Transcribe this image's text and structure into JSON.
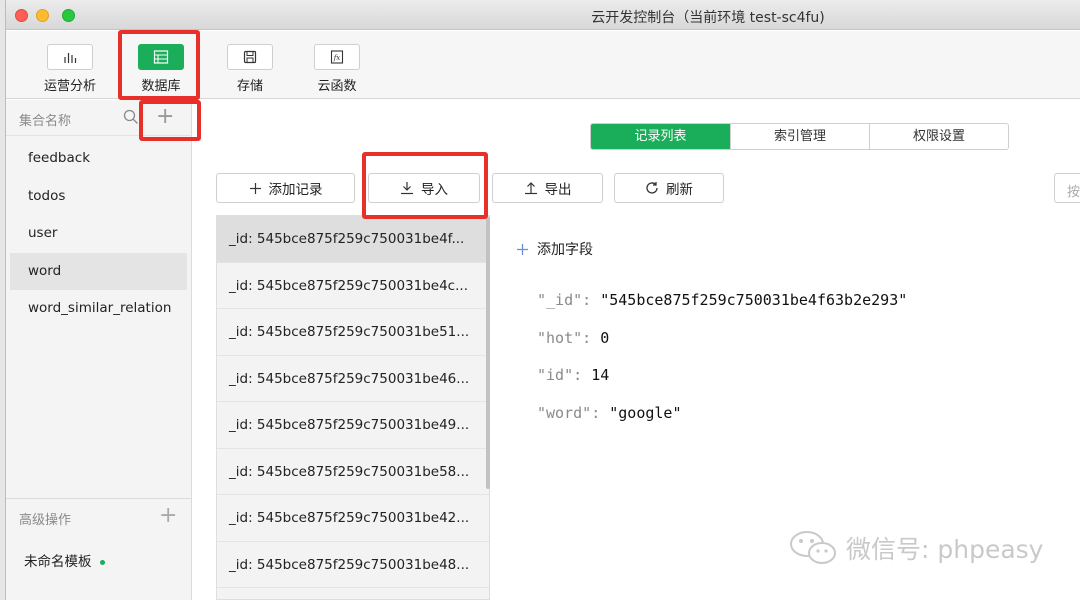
{
  "window": {
    "title": "云开发控制台（当前环境 test-sc4fu)"
  },
  "toolbar": {
    "items": [
      {
        "label": "运营分析",
        "icon": "bar-chart-icon"
      },
      {
        "label": "数据库",
        "icon": "database-icon",
        "active": true
      },
      {
        "label": "存储",
        "icon": "save-disk-icon"
      },
      {
        "label": "云函数",
        "icon": "function-icon"
      }
    ]
  },
  "sidebar": {
    "header": "集合名称",
    "collections": [
      "feedback",
      "todos",
      "user",
      "word",
      "word_similar_relation"
    ],
    "selected": "word",
    "advanced_header": "高级操作",
    "template": "未命名模板"
  },
  "tabs": [
    {
      "label": "记录列表",
      "active": true
    },
    {
      "label": "索引管理"
    },
    {
      "label": "权限设置"
    }
  ],
  "actions": {
    "add": "添加记录",
    "import": "导入",
    "export": "导出",
    "refresh": "刷新",
    "search_placeholder": "按"
  },
  "records": [
    "_id: 545bce875f259c750031be4f...",
    "_id: 545bce875f259c750031be4c...",
    "_id: 545bce875f259c750031be51...",
    "_id: 545bce875f259c750031be46...",
    "_id: 545bce875f259c750031be49...",
    "_id: 545bce875f259c750031be58...",
    "_id: 545bce875f259c750031be42...",
    "_id: 545bce875f259c750031be48..."
  ],
  "detail": {
    "add_field": "添加字段",
    "fields": [
      {
        "key": "\"_id\"",
        "value": "\"545bce875f259c750031be4f63b2e293\""
      },
      {
        "key": "\"hot\"",
        "value": "0"
      },
      {
        "key": "\"id\"",
        "value": "14"
      },
      {
        "key": "\"word\"",
        "value": "\"google\""
      }
    ]
  },
  "watermark": "微信号: phpeasy",
  "colors": {
    "accent": "#1aad5a",
    "highlight": "#e8302a"
  }
}
